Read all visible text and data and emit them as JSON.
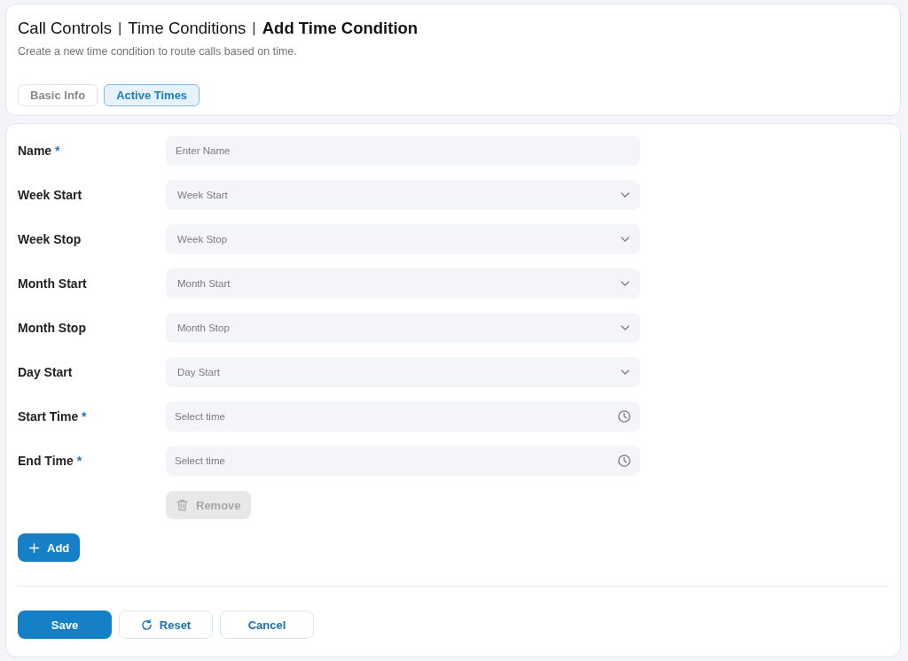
{
  "header": {
    "breadcrumb": [
      {
        "label": "Call Controls",
        "current": false
      },
      {
        "label": "Time Conditions",
        "current": false
      },
      {
        "label": "Add Time Condition",
        "current": true
      }
    ],
    "separator": "|",
    "subtitle": "Create a new time condition to route calls based on time."
  },
  "tabs": [
    {
      "label": "Basic Info",
      "selected": false
    },
    {
      "label": "Active Times",
      "selected": true
    }
  ],
  "form": {
    "required_mark": "*",
    "fields": [
      {
        "label": "Name",
        "required": true,
        "kind": "text",
        "placeholder": "Enter Name"
      },
      {
        "label": "Week Start",
        "required": false,
        "kind": "select",
        "placeholder": "Week Start"
      },
      {
        "label": "Week Stop",
        "required": false,
        "kind": "select",
        "placeholder": "Week Stop"
      },
      {
        "label": "Month Start",
        "required": false,
        "kind": "select",
        "placeholder": "Month Start"
      },
      {
        "label": "Month Stop",
        "required": false,
        "kind": "select",
        "placeholder": "Month Stop"
      },
      {
        "label": "Day Start",
        "required": false,
        "kind": "select",
        "placeholder": "Day Start"
      },
      {
        "label": "Start Time",
        "required": true,
        "kind": "time",
        "placeholder": "Select time"
      },
      {
        "label": "End Time",
        "required": true,
        "kind": "time",
        "placeholder": "Select time"
      }
    ],
    "remove_button": {
      "label": "Remove",
      "disabled": true
    },
    "add_button": {
      "label": "Add"
    }
  },
  "actions": [
    {
      "label": "Save",
      "kind": "primary"
    },
    {
      "label": "Reset",
      "kind": "reset"
    },
    {
      "label": "Cancel",
      "kind": "secondary"
    }
  ]
}
